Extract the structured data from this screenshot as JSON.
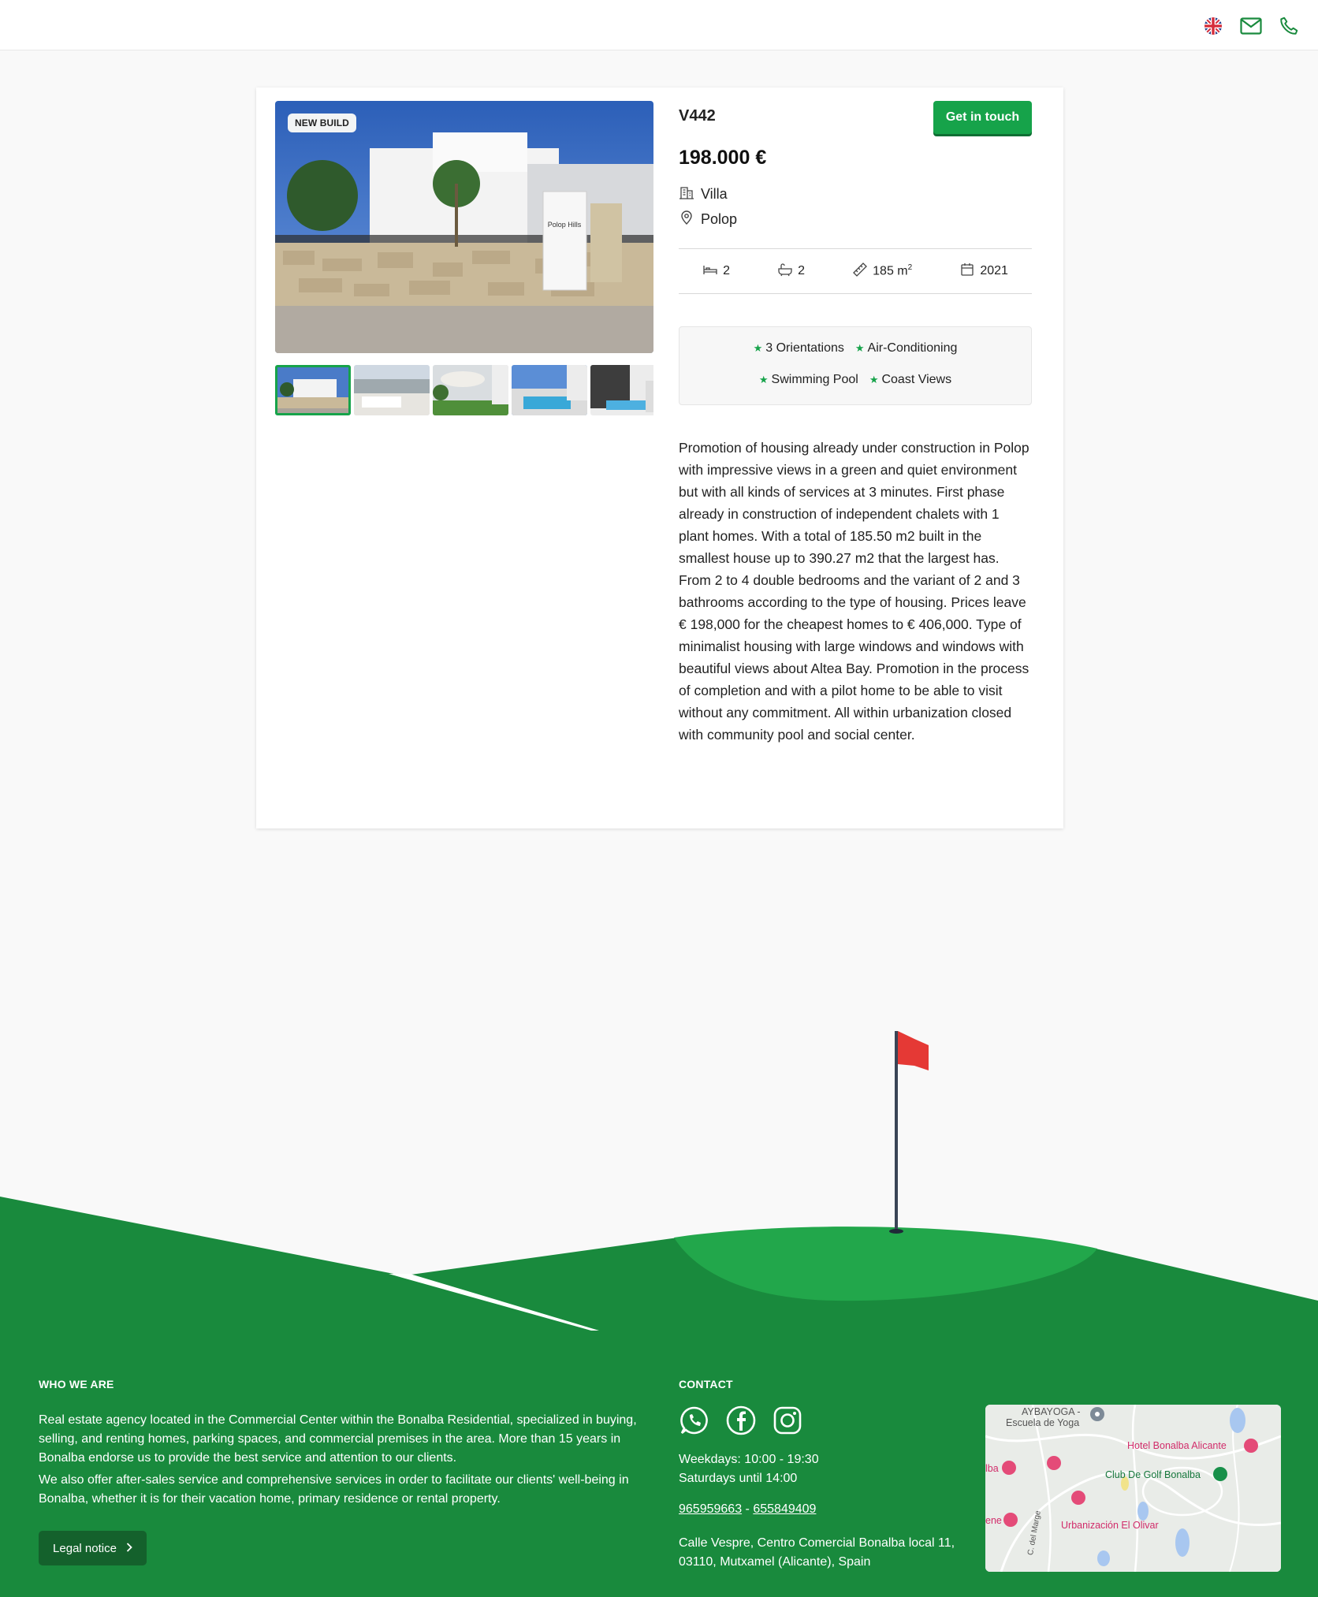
{
  "header": {
    "icons": [
      "uk-flag-icon",
      "mail-icon",
      "phone-icon"
    ]
  },
  "property": {
    "badge": "NEW BUILD",
    "reference": "V442",
    "contact_button": "Get in touch",
    "price": "198.000 €",
    "type": "Villa",
    "location": "Polop",
    "bedrooms": "2",
    "bathrooms": "2",
    "area": "185 m",
    "area_unit_sup": "2",
    "year": "2021",
    "features": [
      "3 Orientations",
      "Air-Conditioning",
      "Swimming Pool",
      "Coast Views"
    ],
    "description": "Promotion of housing already under construction in Polop with impressive views in a green and quiet environment but with all kinds of services at 3 minutes. First phase already in construction of independent chalets with 1 plant homes. With a total of 185.50 m2 built in the smallest house up to 390.27 m2 that the largest has. From 2 to 4 double bedrooms and the variant of 2 and 3 bathrooms according to the type of housing. Prices leave € 198,000 for the cheapest homes to € 406,000. Type of minimalist housing with large windows and windows with beautiful views about Altea Bay. Promotion in the process of completion and with a pilot home to be able to visit without any commitment. All within urbanization closed with community pool and social center."
  },
  "footer": {
    "who_heading": "WHO WE ARE",
    "who_p1": "Real estate agency located in the Commercial Center within the Bonalba Residential, specialized in buying, selling, and renting homes, parking spaces, and commercial premises in the area. More than 15 years in Bonalba endorse us to provide the best service and attention to our clients.",
    "who_p2": "We also offer after-sales service and comprehensive services in order to facilitate our clients' well-being in Bonalba, whether it is for their vacation home, primary residence or rental property.",
    "legal": "Legal notice",
    "contact_heading": "CONTACT",
    "weekdays": "Weekdays: 10:00 - 19:30",
    "saturdays": "Saturdays until 14:00",
    "phone1": "965959663",
    "phone_sep": "-",
    "phone2": "655849409",
    "address_line1": "Calle Vespre, Centro Comercial Bonalba local 11,",
    "address_line2": "03110, Mutxamel (Alicante), Spain",
    "map_labels": {
      "aybayoga": "AYBAYOGA -",
      "escuela": "Escuela de Yoga",
      "hotel": "Hotel Bonalba Alicante",
      "golf": "Club De Golf Bonalba",
      "urb": "Urbanización El Olivar",
      "street": "C. del Marge",
      "left1": "lba",
      "left2": "ene"
    }
  }
}
